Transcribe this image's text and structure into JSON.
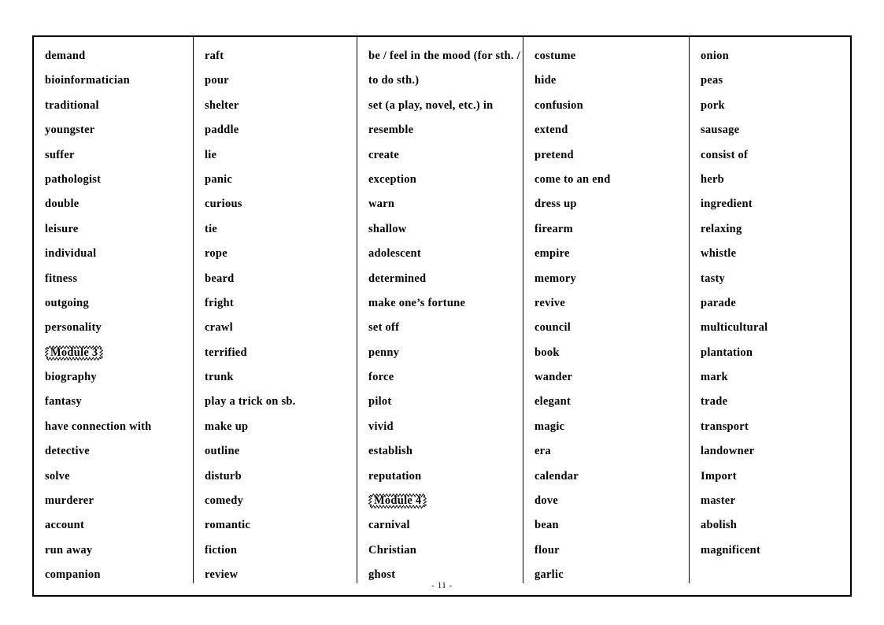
{
  "document": {
    "page_number_label": "- 11 -",
    "module_marker_style": "wavy-border"
  },
  "columns": [
    {
      "index": 0,
      "items": [
        {
          "text": "demand",
          "type": "word"
        },
        {
          "text": "bioinformatician",
          "type": "word"
        },
        {
          "text": "traditional",
          "type": "word"
        },
        {
          "text": "youngster",
          "type": "word"
        },
        {
          "text": "suffer",
          "type": "word"
        },
        {
          "text": "pathologist",
          "type": "word"
        },
        {
          "text": "double",
          "type": "word"
        },
        {
          "text": "leisure",
          "type": "word"
        },
        {
          "text": "individual",
          "type": "word"
        },
        {
          "text": "fitness",
          "type": "word"
        },
        {
          "text": "outgoing",
          "type": "word"
        },
        {
          "text": "personality",
          "type": "word"
        },
        {
          "text": "Module 3",
          "type": "module"
        },
        {
          "text": "biography",
          "type": "word"
        },
        {
          "text": "fantasy",
          "type": "word"
        },
        {
          "text": "have connection with",
          "type": "word"
        },
        {
          "text": "detective",
          "type": "word"
        },
        {
          "text": "solve",
          "type": "word"
        },
        {
          "text": "murderer",
          "type": "word"
        },
        {
          "text": "account",
          "type": "word"
        },
        {
          "text": "run away",
          "type": "word"
        },
        {
          "text": "companion",
          "type": "word"
        }
      ]
    },
    {
      "index": 1,
      "items": [
        {
          "text": "raft",
          "type": "word"
        },
        {
          "text": "pour",
          "type": "word"
        },
        {
          "text": "shelter",
          "type": "word"
        },
        {
          "text": "paddle",
          "type": "word"
        },
        {
          "text": "lie",
          "type": "word"
        },
        {
          "text": "panic",
          "type": "word"
        },
        {
          "text": "curious",
          "type": "word"
        },
        {
          "text": "tie",
          "type": "word"
        },
        {
          "text": "rope",
          "type": "word"
        },
        {
          "text": "beard",
          "type": "word"
        },
        {
          "text": "fright",
          "type": "word"
        },
        {
          "text": "crawl",
          "type": "word"
        },
        {
          "text": "terrified",
          "type": "word"
        },
        {
          "text": "trunk",
          "type": "word"
        },
        {
          "text": "play a trick on sb.",
          "type": "word"
        },
        {
          "text": "make up",
          "type": "word"
        },
        {
          "text": "outline",
          "type": "word"
        },
        {
          "text": "disturb",
          "type": "word"
        },
        {
          "text": "comedy",
          "type": "word"
        },
        {
          "text": "romantic",
          "type": "word"
        },
        {
          "text": "fiction",
          "type": "word"
        },
        {
          "text": "review",
          "type": "word"
        }
      ]
    },
    {
      "index": 2,
      "items": [
        {
          "text": "be / feel in the mood (for sth. / to do sth.)",
          "type": "word-wrap2"
        },
        {
          "text": "set (a play, novel, etc.) in",
          "type": "word"
        },
        {
          "text": "resemble",
          "type": "word"
        },
        {
          "text": "create",
          "type": "word"
        },
        {
          "text": "exception",
          "type": "word"
        },
        {
          "text": "warn",
          "type": "word"
        },
        {
          "text": "shallow",
          "type": "word"
        },
        {
          "text": "adolescent",
          "type": "word"
        },
        {
          "text": "determined",
          "type": "word"
        },
        {
          "text": "make one’s fortune",
          "type": "word"
        },
        {
          "text": "set off",
          "type": "word"
        },
        {
          "text": "penny",
          "type": "word"
        },
        {
          "text": "force",
          "type": "word"
        },
        {
          "text": "pilot",
          "type": "word"
        },
        {
          "text": "vivid",
          "type": "word"
        },
        {
          "text": "establish",
          "type": "word"
        },
        {
          "text": "reputation",
          "type": "word"
        },
        {
          "text": "Module 4",
          "type": "module"
        },
        {
          "text": "carnival",
          "type": "word"
        },
        {
          "text": "Christian",
          "type": "word"
        },
        {
          "text": "ghost",
          "type": "word"
        }
      ]
    },
    {
      "index": 3,
      "items": [
        {
          "text": "costume",
          "type": "word"
        },
        {
          "text": "hide",
          "type": "word"
        },
        {
          "text": "confusion",
          "type": "word"
        },
        {
          "text": "extend",
          "type": "word"
        },
        {
          "text": "pretend",
          "type": "word"
        },
        {
          "text": "come to an end",
          "type": "word"
        },
        {
          "text": "dress up",
          "type": "word"
        },
        {
          "text": "firearm",
          "type": "word"
        },
        {
          "text": "empire",
          "type": "word"
        },
        {
          "text": "memory",
          "type": "word"
        },
        {
          "text": "revive",
          "type": "word"
        },
        {
          "text": "council",
          "type": "word"
        },
        {
          "text": "book",
          "type": "word"
        },
        {
          "text": "wander",
          "type": "word"
        },
        {
          "text": "elegant",
          "type": "word"
        },
        {
          "text": "magic",
          "type": "word"
        },
        {
          "text": "era",
          "type": "word"
        },
        {
          "text": "calendar",
          "type": "word"
        },
        {
          "text": "dove",
          "type": "word"
        },
        {
          "text": "bean",
          "type": "word"
        },
        {
          "text": "flour",
          "type": "word"
        },
        {
          "text": "garlic",
          "type": "word"
        }
      ]
    },
    {
      "index": 4,
      "items": [
        {
          "text": "onion",
          "type": "word"
        },
        {
          "text": "peas",
          "type": "word"
        },
        {
          "text": "pork",
          "type": "word"
        },
        {
          "text": "sausage",
          "type": "word"
        },
        {
          "text": "consist of",
          "type": "word"
        },
        {
          "text": "herb",
          "type": "word"
        },
        {
          "text": "ingredient",
          "type": "word"
        },
        {
          "text": "relaxing",
          "type": "word"
        },
        {
          "text": "whistle",
          "type": "word"
        },
        {
          "text": "tasty",
          "type": "word"
        },
        {
          "text": "parade",
          "type": "word"
        },
        {
          "text": "multicultural",
          "type": "word"
        },
        {
          "text": "plantation",
          "type": "word"
        },
        {
          "text": "mark",
          "type": "word"
        },
        {
          "text": "trade",
          "type": "word"
        },
        {
          "text": "transport",
          "type": "word"
        },
        {
          "text": "landowner",
          "type": "word"
        },
        {
          "text": "Import",
          "type": "word"
        },
        {
          "text": "master",
          "type": "word"
        },
        {
          "text": "abolish",
          "type": "word"
        },
        {
          "text": "magnificent",
          "type": "word"
        }
      ]
    }
  ]
}
